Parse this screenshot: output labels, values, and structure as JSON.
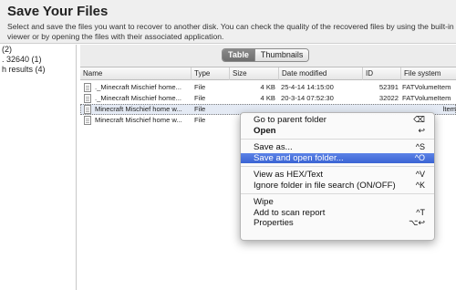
{
  "header": {
    "title": "Save Your Files",
    "description": "Select and save the files you want to recover to another disk. You can check the quality of the recovered files by using the built-in viewer or by opening the files with their associated application."
  },
  "sidebar": {
    "items": [
      {
        "label": "(2)"
      },
      {
        "label": ". 32640 (1)"
      },
      {
        "label": "h results (4)"
      }
    ]
  },
  "view_toggle": {
    "table_label": "Table",
    "thumbnails_label": "Thumbnails",
    "selected": "Table"
  },
  "table": {
    "columns": [
      "Name",
      "Type",
      "Size",
      "Date modified",
      "ID",
      "File system"
    ],
    "rows": [
      {
        "name": "._Minecraft Mischief home...",
        "type": "File",
        "size": "4 KB",
        "date": "25-4-14 14:15:00",
        "id": "52391",
        "fs": "FATVolumeItem",
        "selected": false
      },
      {
        "name": "._Minecraft Mischief home...",
        "type": "File",
        "size": "4 KB",
        "date": "20-3-14 07:52:30",
        "id": "32022",
        "fs": "FATVolumeItem",
        "selected": false
      },
      {
        "name": "Minecraft Mischief home w...",
        "type": "File",
        "size": "",
        "date": "",
        "id": "",
        "fs": "ltem",
        "selected": true
      },
      {
        "name": "Minecraft Mischief home w...",
        "type": "File",
        "size": "",
        "date": "",
        "id": "",
        "fs": "",
        "selected": false
      }
    ]
  },
  "context_menu": {
    "items": [
      {
        "label": "Go to parent folder",
        "shortcut": "⌫"
      },
      {
        "label": "Open",
        "shortcut": "↩"
      },
      {
        "label": "Save as...",
        "shortcut": "^S"
      },
      {
        "label": "Save and open folder...",
        "shortcut": "^O"
      },
      {
        "label": "View as HEX/Text",
        "shortcut": "^V"
      },
      {
        "label": "Ignore folder in file search (ON/OFF)",
        "shortcut": "^K"
      },
      {
        "label": "Wipe",
        "shortcut": ""
      },
      {
        "label": "Add to scan report",
        "shortcut": "^T"
      },
      {
        "label": "Properties",
        "shortcut": "⌥↩"
      }
    ]
  },
  "colors": {
    "highlight": "#3a64d4",
    "selected_row": "#e4eaf4",
    "segment_active": "#7a7a7a"
  }
}
